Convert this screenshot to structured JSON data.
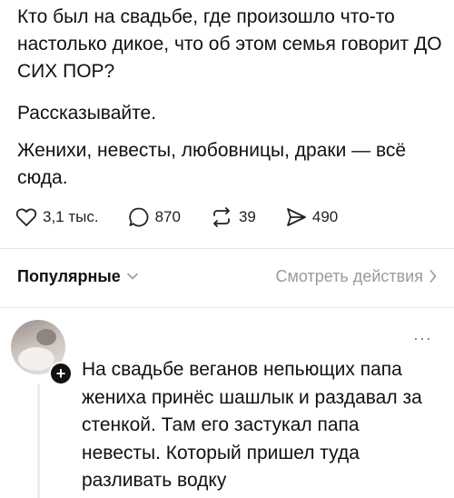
{
  "post": {
    "paragraphs": [
      "Кто был на свадьбе, где произошло что-то настолько дикое, что об этом семья говорит ДО СИХ ПОР?",
      "Рассказывайте.",
      "Женихи, невесты, любовницы, драки — всё сюда."
    ],
    "likes": "3,1 тыс.",
    "comments": "870",
    "reposts": "39",
    "shares": "490"
  },
  "sort_bar": {
    "sort_label": "Популярные",
    "view_activity_label": "Смотреть действия"
  },
  "comment": {
    "text": "На свадьбе веганов непьющих папа жениха принёс шашлык и раздавал за стенкой. Там его застукал папа невесты. Который пришел туда разливать водку",
    "more": "···",
    "plus": "+"
  },
  "icons": {
    "like": "heart-icon",
    "comment": "speech-bubble-icon",
    "repost": "repost-arrows-icon",
    "share": "send-icon",
    "sort": "chevron-down-icon",
    "activity": "chevron-right-icon"
  },
  "colors": {
    "text": "#111111",
    "muted": "#9a9a9a",
    "divider": "#e6e6e6"
  }
}
